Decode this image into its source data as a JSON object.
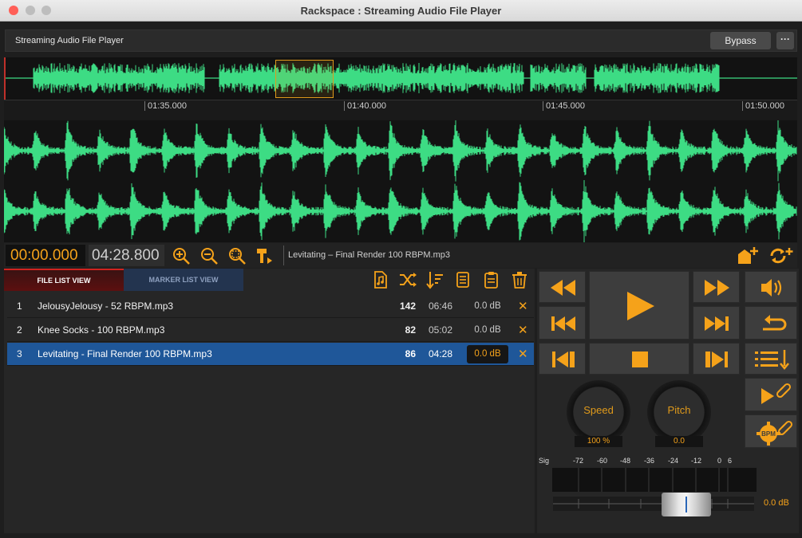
{
  "window": {
    "title": "Rackspace : Streaming Audio File Player"
  },
  "plugin": {
    "name": "Streaming Audio File Player",
    "bypass_label": "Bypass",
    "more_label": "···"
  },
  "timeline": {
    "ticks": [
      "01:35.000",
      "01:40.000",
      "01:45.000",
      "01:50.000"
    ]
  },
  "transport": {
    "position": "00:00.000",
    "length": "04:28.800",
    "current_file": "Levitating – Final Render 100 RBPM.mp3"
  },
  "tabs": {
    "file_list": "FILE LIST VIEW",
    "marker_list": "MARKER LIST VIEW"
  },
  "files": [
    {
      "index": "1",
      "name": "JelousyJelousy - 52 RBPM.mp3",
      "bpm": "142",
      "duration": "06:46",
      "gain": "0.0 dB",
      "selected": false
    },
    {
      "index": "2",
      "name": "Knee Socks - 100 RBPM.mp3",
      "bpm": "82",
      "duration": "05:02",
      "gain": "0.0 dB",
      "selected": false
    },
    {
      "index": "3",
      "name": "Levitating - Final Render 100 RBPM.mp3",
      "bpm": "86",
      "duration": "04:28",
      "gain": "0.0 dB",
      "selected": true
    }
  ],
  "knobs": {
    "speed": {
      "label": "Speed",
      "value": "100 %"
    },
    "pitch": {
      "label": "Pitch",
      "value": "0.0"
    }
  },
  "meter": {
    "sig_label": "Sig",
    "scale": [
      "-72",
      "-60",
      "-48",
      "-36",
      "-24",
      "-12",
      "0",
      "6"
    ],
    "gain": "0.0 dB"
  },
  "bpm_badge": "BPM",
  "colors": {
    "accent": "#f5a21a",
    "wave": "#3ddc84",
    "selection": "#1f5799",
    "tab_active": "#d0231f"
  }
}
